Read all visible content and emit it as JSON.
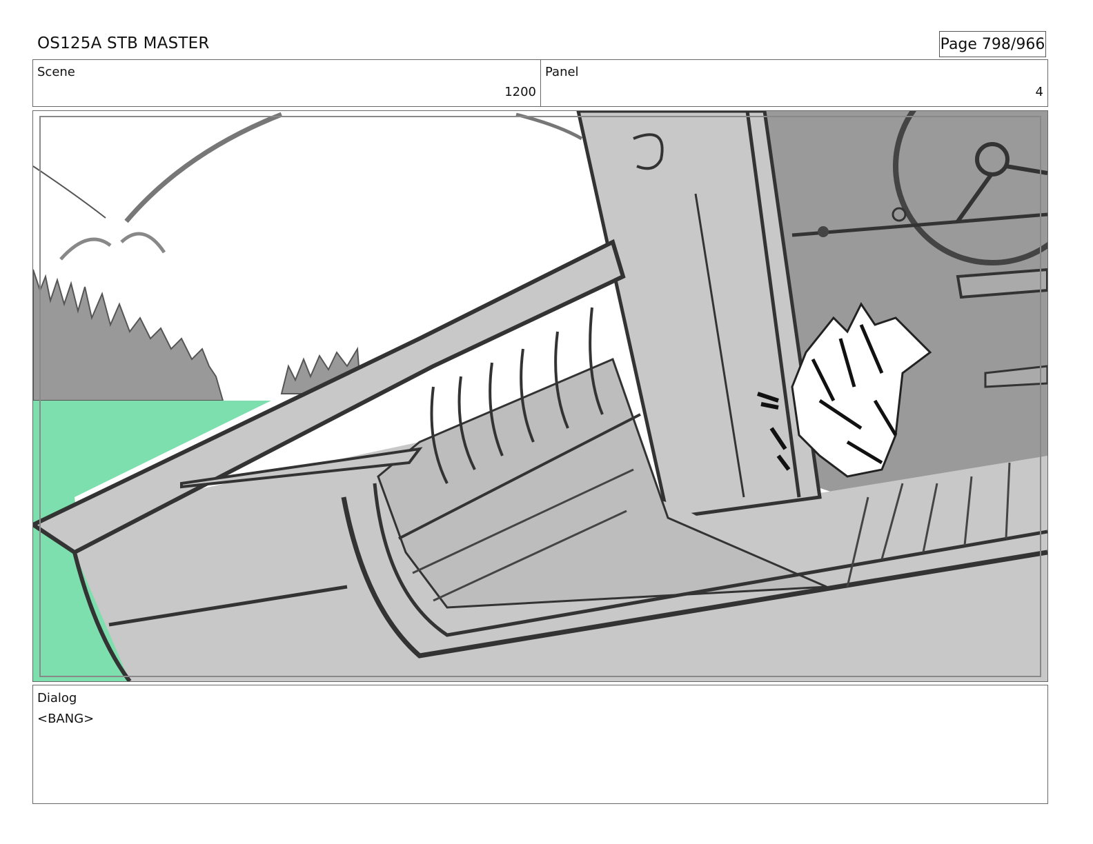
{
  "header": {
    "title": "OS125A STB MASTER",
    "page": "Page 798/966"
  },
  "scene": {
    "label": "Scene",
    "value": "1200"
  },
  "panel": {
    "label": "Panel",
    "value": "4"
  },
  "dialog": {
    "label": "Dialog",
    "text": "<BANG>"
  },
  "colors": {
    "water": "#7ddfae",
    "boat_gray": "#c8c8c8",
    "dark_gray": "#9a9a9a",
    "ink": "#333333"
  }
}
